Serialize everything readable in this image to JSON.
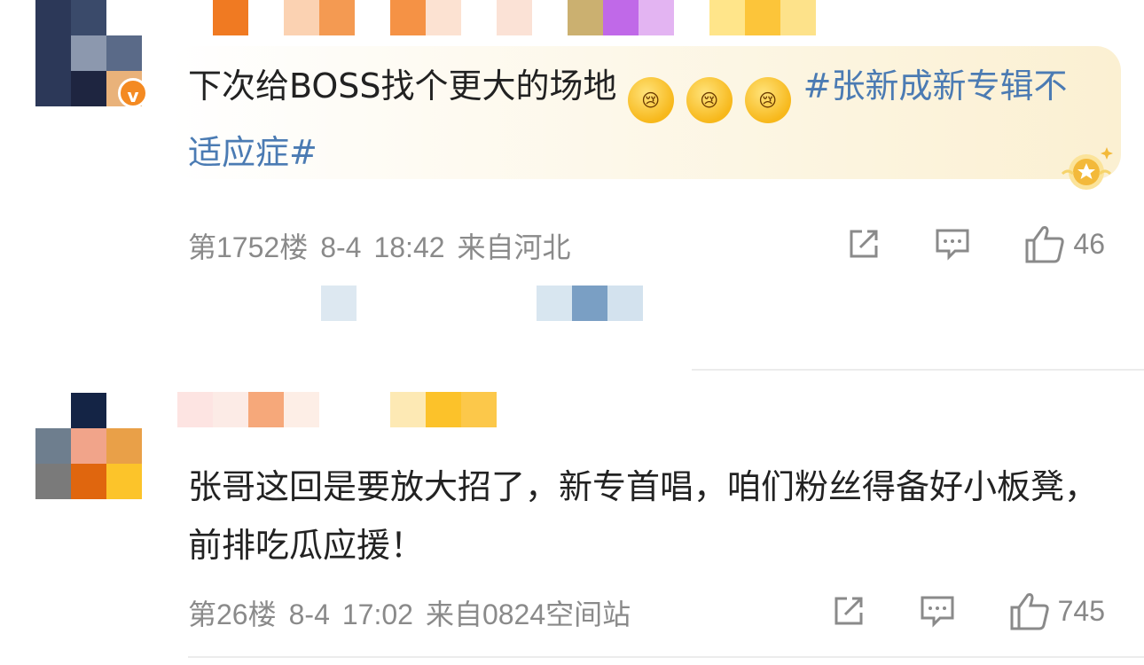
{
  "comments": [
    {
      "text_plain": "下次给BOSS找个更大的场地",
      "emoji_alt": [
        "😢",
        "😢",
        "😢"
      ],
      "topic": "#张新成新专辑不适应症#",
      "floor": "第1752楼",
      "date": "8-4",
      "time": "18:42",
      "source": "来自河北",
      "like_count": "46"
    },
    {
      "text": "张哥这回是要放大招了，新专首唱，咱们粉丝得备好小板凳，前排吃瓜应援！",
      "floor": "第26楼",
      "date": "8-4",
      "time": "17:02",
      "source": "来自0824空间站",
      "like_count": "745"
    }
  ],
  "icons": {
    "repost": "repost-icon",
    "comment": "comment-icon",
    "like": "like-icon",
    "verified": "verified-badge-icon",
    "medal": "fan-medal-icon"
  },
  "colors": {
    "topic_link": "#4b7bb3",
    "verified_badge": "#f48a22",
    "meta_text": "#8a8a8a"
  }
}
